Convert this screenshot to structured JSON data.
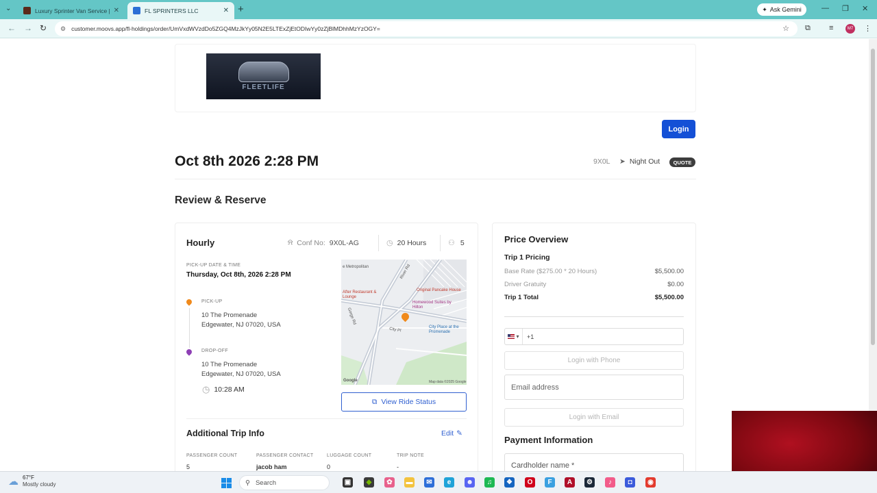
{
  "browser": {
    "tabs": [
      {
        "title": "Luxury Sprinter Van Service | Ed",
        "active": false
      },
      {
        "title": "FL SPRINTERS LLC",
        "active": true
      }
    ],
    "ask_gemini": "Ask Gemini",
    "url": "customer.moovs.app/fl-holdings/order/UmVxdWVzdDo5ZGQ4MzJkYy05N2E5LTExZjEtODIwYy0zZjBlMDhhMzYzOGY=",
    "profile_initials": "M7"
  },
  "header": {
    "logo_text": "FLEETLIFE",
    "login_label": "Login"
  },
  "trip": {
    "date_title": "Oct 8th 2026 2:28 PM",
    "code": "9X0L",
    "name": "Night Out",
    "status_badge": "QUOTE"
  },
  "section_title": "Review & Reserve",
  "trip_card": {
    "service_type": "Hourly",
    "conf_label": "Conf No:",
    "conf_no": "9X0L-AG",
    "hours": "20 Hours",
    "passengers": "5",
    "pickup_datetime_label": "PICK-UP DATE & TIME",
    "pickup_datetime": "Thursday, Oct 8th, 2026 2:28 PM",
    "pickup_label": "PICK-UP",
    "pickup_line1": "10 The Promenade",
    "pickup_line2": "Edgewater, NJ 07020, USA",
    "dropoff_label": "DROP-OFF",
    "dropoff_line1": "10 The Promenade",
    "dropoff_line2": "Edgewater, NJ 07020, USA",
    "dropoff_time": "10:28 AM",
    "view_status_label": "View Ride Status",
    "map": {
      "labels": [
        "e Metropolitan",
        "After Restaurant & Lounge",
        "Original Pancake House",
        "Homewood Suites by Hilton",
        "City Place at the Promenade",
        "River Rd",
        "Gorge Rd",
        "City Pl",
        "Google",
        "Map data ©2025 Google"
      ]
    }
  },
  "additional_info": {
    "title": "Additional Trip Info",
    "edit_label": "Edit",
    "columns": [
      {
        "header": "PASSENGER COUNT",
        "value": "5"
      },
      {
        "header": "PASSENGER CONTACT",
        "value": "jacob ham"
      },
      {
        "header": "LUGGAGE COUNT",
        "value": "0"
      },
      {
        "header": "TRIP NOTE",
        "value": "-"
      }
    ]
  },
  "price": {
    "title": "Price Overview",
    "subtitle": "Trip 1 Pricing",
    "rows": [
      {
        "label": "Base Rate ($275.00 * 20 Hours)",
        "value": "$5,500.00"
      },
      {
        "label": "Driver Gratuity",
        "value": "$0.00"
      },
      {
        "label": "Trip 1 Total",
        "value": "$5,500.00"
      }
    ]
  },
  "auth": {
    "phone_value": "+1",
    "login_phone_label": "Login with Phone",
    "email_placeholder": "Email address",
    "login_email_label": "Login with Email"
  },
  "payment": {
    "title": "Payment Information",
    "cardholder_placeholder": "Cardholder name *"
  },
  "taskbar": {
    "temp": "67°F",
    "weather": "Mostly cloudy",
    "search_label": "Search"
  },
  "colors": {
    "primary": "#1450d6",
    "tabbar": "#64c6c6",
    "pickup_pin": "#f08a1c",
    "dropoff_pin": "#8e3fb5"
  }
}
